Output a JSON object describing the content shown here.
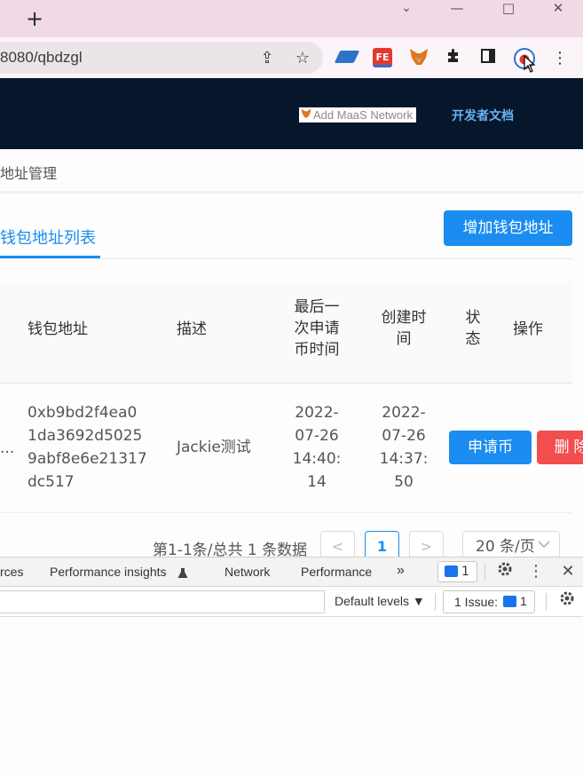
{
  "browser": {
    "url": "8080/qbdzgl",
    "icons": {
      "new_tab": "+",
      "minimize": "—",
      "restore": "□",
      "close": "✕",
      "share": "⇪",
      "bookmark": "☆",
      "puzzle": "✚",
      "sidepanel": "▣",
      "menu": "⋮"
    },
    "extension_fe_label": "FE"
  },
  "app_header": {
    "add_network": "Add MaaS Network",
    "dev_docs": "开发者文档"
  },
  "breadcrumb": "地址管理",
  "tabs": {
    "active": "钱包地址列表"
  },
  "add_wallet_button": "增加钱包地址",
  "table": {
    "headers": {
      "address": "钱包地址",
      "description": "描述",
      "last_apply_1": "最后一",
      "last_apply_2": "次申请",
      "last_apply_3": "币时间",
      "created_1": "创建时",
      "created_2": "间",
      "status_1": "状",
      "status_2": "态",
      "actions": "操作"
    },
    "rows": [
      {
        "ellipsis": "...",
        "address_1": "0xb9bd2f4ea0",
        "address_2": "1da3692d5025",
        "address_3": "9abf8e6e21317",
        "address_4": "dc517",
        "description": "Jackie测试",
        "last_apply_1": "2022-",
        "last_apply_2": "07-26",
        "last_apply_3": "14:40:",
        "last_apply_4": "14",
        "created_1": "2022-",
        "created_2": "07-26",
        "created_3": "14:37:",
        "created_4": "50",
        "apply_button": "申请币",
        "delete_button": "删 除"
      }
    ]
  },
  "pagination": {
    "total": "第1-1条/总共 1 条数据",
    "prev": "<",
    "current": "1",
    "next": ">",
    "page_size": "20 条/页"
  },
  "devtools": {
    "tabs": {
      "sources": "rces",
      "performance_insights": "Performance insights",
      "network": "Network",
      "performance": "Performance",
      "more": "»"
    },
    "message_count": "1",
    "default_levels": "Default levels ▼",
    "issues_label": "1 Issue:",
    "issues_count": "1"
  },
  "colors": {
    "accent": "#1b8cf0",
    "danger": "#f24e4e",
    "header_bg": "#07172b",
    "tab_strip": "#f1d9e5"
  }
}
